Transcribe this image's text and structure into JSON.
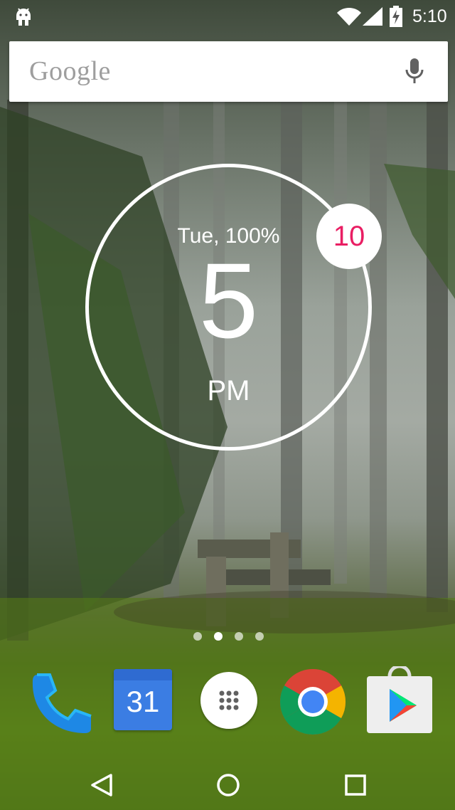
{
  "status_bar": {
    "time": "5:10",
    "icons": [
      "android-debug-icon",
      "wifi-icon",
      "cell-signal-icon",
      "battery-charging-icon"
    ]
  },
  "search": {
    "logo_text": "Google",
    "mic_icon": "mic-icon"
  },
  "clock_widget": {
    "date_battery": "Tue, 100%",
    "hour": "5",
    "ampm": "PM",
    "badge_count": "10",
    "badge_color": "#e91e63"
  },
  "pager": {
    "page_count": 4,
    "active_page": 1
  },
  "dock": {
    "items": [
      {
        "icon": "phone-icon"
      },
      {
        "icon": "calendar-icon",
        "label": "31"
      },
      {
        "icon": "app-drawer-icon"
      },
      {
        "icon": "chrome-icon"
      },
      {
        "icon": "play-store-icon"
      }
    ]
  },
  "nav_bar": {
    "icons": [
      "back-icon",
      "home-icon",
      "recents-icon"
    ]
  }
}
